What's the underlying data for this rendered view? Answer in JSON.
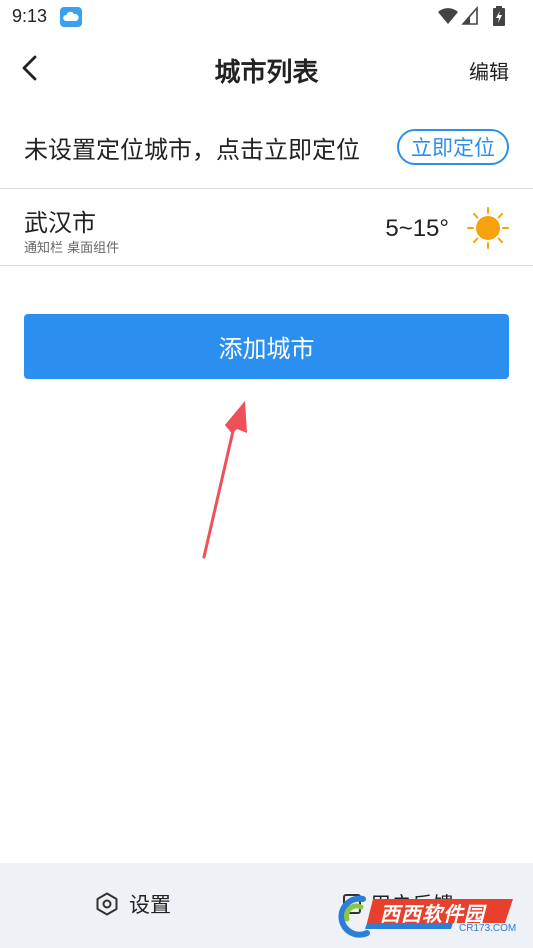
{
  "status_bar": {
    "time": "9:13",
    "icons": [
      "cloud-icon",
      "wifi-icon",
      "signal-icon",
      "battery-icon"
    ]
  },
  "nav": {
    "title": "城市列表",
    "edit_label": "编辑",
    "back_icon": "chevron-left-icon"
  },
  "locate": {
    "text": "未设置定位城市，点击立即定位",
    "button_label": "立即定位"
  },
  "cities": [
    {
      "name": "武汉市",
      "tags": "通知栏 桌面组件",
      "temperature": "5~15°",
      "weather_icon": "sun-icon"
    }
  ],
  "add_city_label": "添加城市",
  "bottom_bar": {
    "settings_label": "设置",
    "settings_icon": "hexagon-gear-icon",
    "feedback_label": "用户反馈",
    "feedback_icon": "feedback-icon"
  },
  "watermark": {
    "text": "西西软件园",
    "sub": "CR173.COM"
  },
  "colors": {
    "accent": "#2b8ff0",
    "bottom_bar": "#eef1f5",
    "annotation_arrow": "#f0505a",
    "sun": "#f5a20c"
  }
}
